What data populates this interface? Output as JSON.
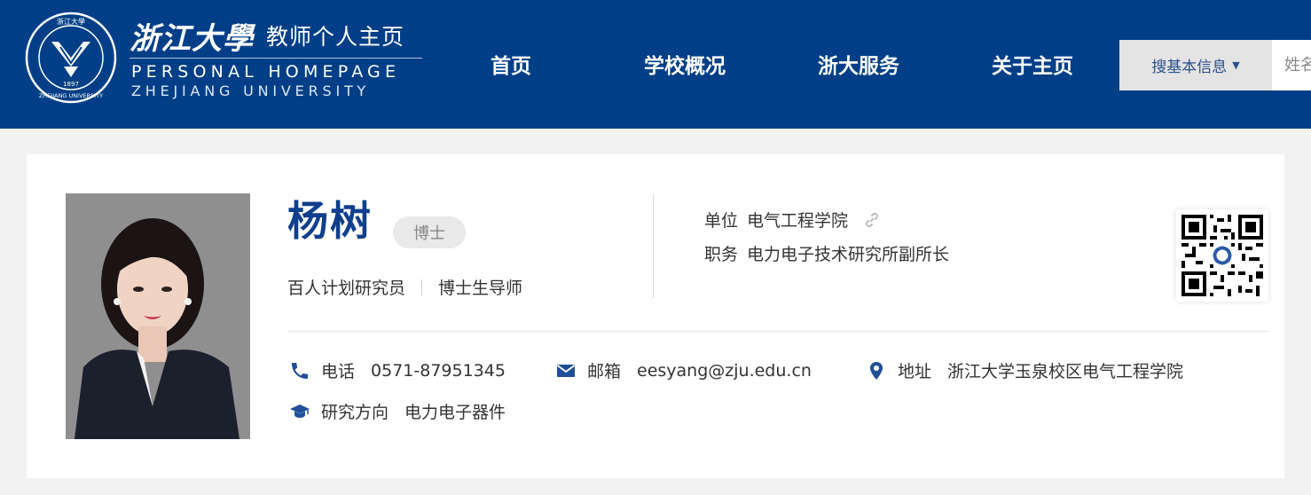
{
  "header": {
    "logo_cn": "浙江大學",
    "logo_sub": "教师个人主页",
    "logo_en1": "PERSONAL HOMEPAGE",
    "logo_en2": "ZHEJIANG UNIVERSITY",
    "seal_text_top": "浙江大學",
    "seal_year": "1897",
    "seal_text_bottom": "ZHEJIANG UNIVERSITY",
    "nav": [
      {
        "label": "首页"
      },
      {
        "label": "学校概况"
      },
      {
        "label": "浙大服务"
      },
      {
        "label": "关于主页"
      }
    ],
    "search": {
      "dropdown_label": "搜基本信息",
      "placeholder": "姓名"
    }
  },
  "profile": {
    "name": "杨树",
    "degree": "博士",
    "positions": [
      "百人计划研究员",
      "博士生导师"
    ],
    "unit_label": "单位",
    "unit_value": "电气工程学院",
    "duty_label": "职务",
    "duty_value": "电力电子技术研究所副所长",
    "phone_label": "电话",
    "phone_value": "0571-87951345",
    "email_label": "邮箱",
    "email_value": "eesyang@zju.edu.cn",
    "address_label": "地址",
    "address_value": "浙江大学玉泉校区电气工程学院",
    "research_label": "研究方向",
    "research_value": "电力电子器件"
  },
  "colors": {
    "header_bg": "#003f88",
    "name_color": "#0f3f8d",
    "icon_color": "#1f4f98"
  },
  "icons": [
    "university-seal-icon",
    "caret-down-icon",
    "link-icon",
    "phone-icon",
    "mail-icon",
    "location-icon",
    "graduation-cap-icon",
    "qr-code-icon"
  ]
}
